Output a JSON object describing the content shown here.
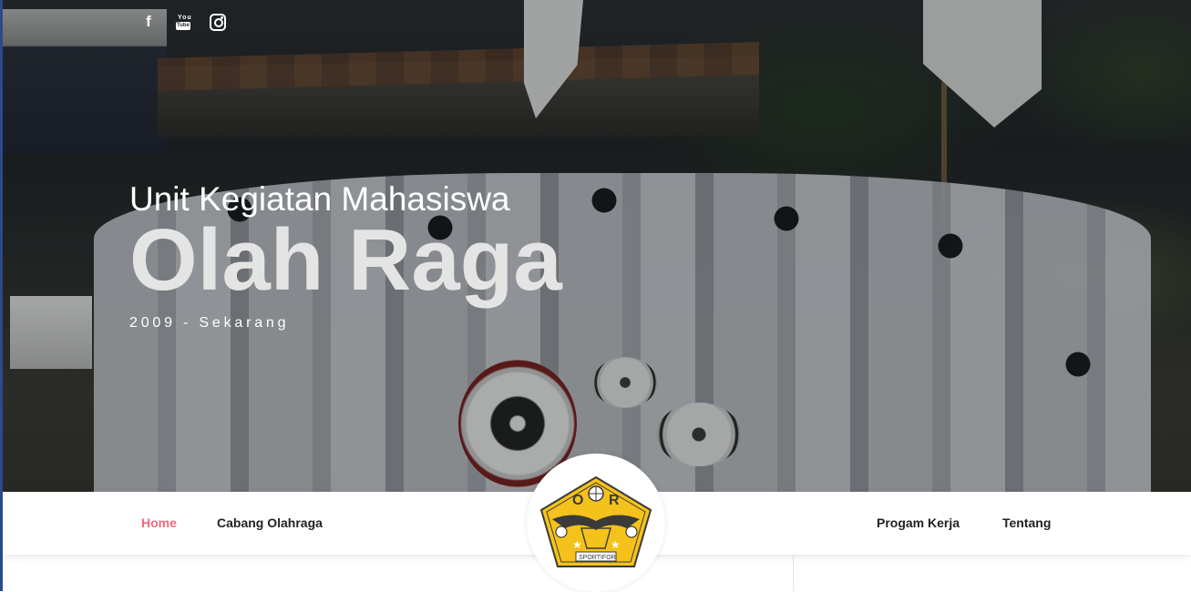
{
  "social": {
    "facebook_glyph": "f",
    "youtube_top": "You",
    "youtube_bottom": "Tube"
  },
  "hero": {
    "kicker": "Unit Kegiatan Mahasiswa",
    "title": "Olah Raga",
    "subtitle": "2009 - Sekarang"
  },
  "nav": {
    "left": [
      {
        "label": "Home",
        "active": true
      },
      {
        "label": "Cabang Olahraga",
        "active": false
      }
    ],
    "right": [
      {
        "label": "Progam Kerja",
        "active": false
      },
      {
        "label": "Tentang",
        "active": false
      }
    ],
    "active_color": "#f06a7c"
  },
  "logo": {
    "letters_left": "O",
    "letters_right": "R",
    "banner_text": "SPORTIFOR",
    "fill_color": "#f4c21a"
  }
}
